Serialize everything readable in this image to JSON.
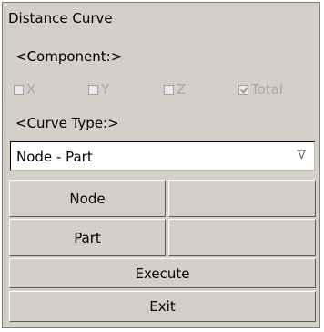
{
  "panel": {
    "title": "Distance Curve",
    "component_header": "<Component:>",
    "components": [
      {
        "label": "X",
        "checked": false
      },
      {
        "label": "Y",
        "checked": false
      },
      {
        "label": "Z",
        "checked": false
      },
      {
        "label": "Total",
        "checked": true
      }
    ],
    "curve_type_header": "<Curve Type:>",
    "curve_type_value": "Node - Part",
    "buttons": {
      "node": "Node",
      "part": "Part",
      "execute": "Execute",
      "exit": "Exit"
    }
  }
}
